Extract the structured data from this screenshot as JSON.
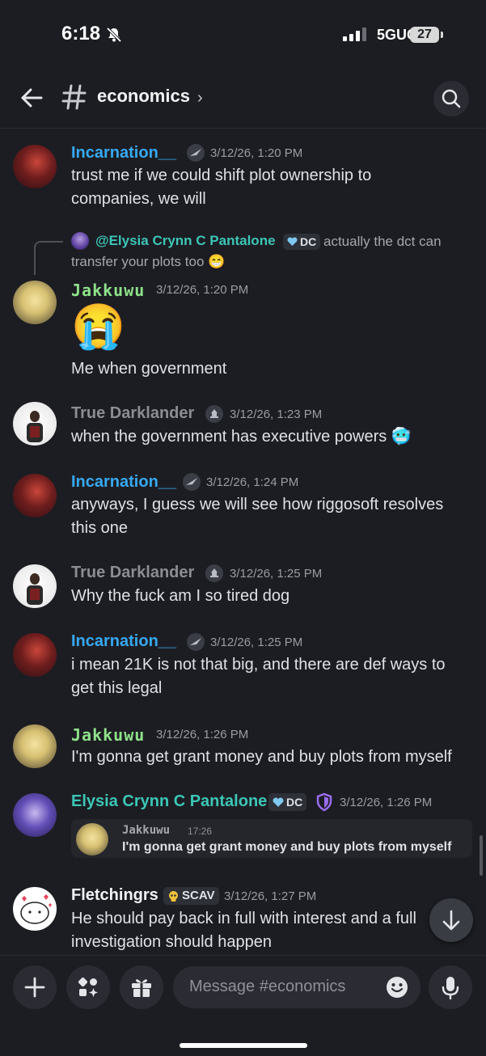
{
  "status_bar": {
    "time": "6:18",
    "network": "5GUC",
    "battery": "27"
  },
  "header": {
    "channel": "economics",
    "chevron": "›"
  },
  "reply": {
    "mention": "@Elysia Crynn C Pantalone",
    "badge": "DC",
    "text_line1": "actually the dct can",
    "text_line2": "transfer your plots too 😁"
  },
  "messages": [
    {
      "user": "Incarnation__",
      "time": "3/12/26, 1:20 PM",
      "lines": [
        "trust me if we could shift plot ownership to",
        "companies, we will"
      ]
    },
    {
      "user": "Jakkuwu",
      "time": "3/12/26, 1:20 PM",
      "emoji": "😭",
      "lines": [
        "Me when government"
      ]
    },
    {
      "user": "True Darklander",
      "time": "3/12/26, 1:23 PM",
      "lines": [
        "when the government has executive powers 🥶"
      ]
    },
    {
      "user": "Incarnation__",
      "time": "3/12/26, 1:24 PM",
      "lines": [
        "anyways, I guess we will see how riggosoft resolves",
        "this one"
      ]
    },
    {
      "user": "True Darklander",
      "time": "3/12/26, 1:25 PM",
      "lines": [
        "Why the fuck am I so tired dog"
      ]
    },
    {
      "user": "Incarnation__",
      "time": "3/12/26, 1:25 PM",
      "lines": [
        "i mean 21K is not that big, and there are def ways to",
        "get this legal"
      ]
    },
    {
      "user": "Jakkuwu",
      "time": "3/12/26, 1:26 PM",
      "lines": [
        "I'm gonna get grant money and buy plots from myself"
      ]
    },
    {
      "user": "Elysia Crynn C Pantalone",
      "badge": "DC",
      "time": "3/12/26, 1:26 PM",
      "quote": {
        "user": "Jakkuwu",
        "time": "17:26",
        "text": "I'm gonna get grant money and buy plots from myself"
      }
    },
    {
      "user": "Fletchingrs",
      "badge": "SCAV",
      "time": "3/12/26, 1:27 PM",
      "lines": [
        "He should pay back in full with interest and a full",
        "investigation should happen"
      ]
    }
  ],
  "composer": {
    "placeholder": "Message #economics"
  },
  "colors": {
    "blue_name": "#36a9f2",
    "green_name": "#8ee28a",
    "gray_name": "#8b8d93",
    "teal_name": "#3cc6b6",
    "bg": "#1c1d22"
  }
}
